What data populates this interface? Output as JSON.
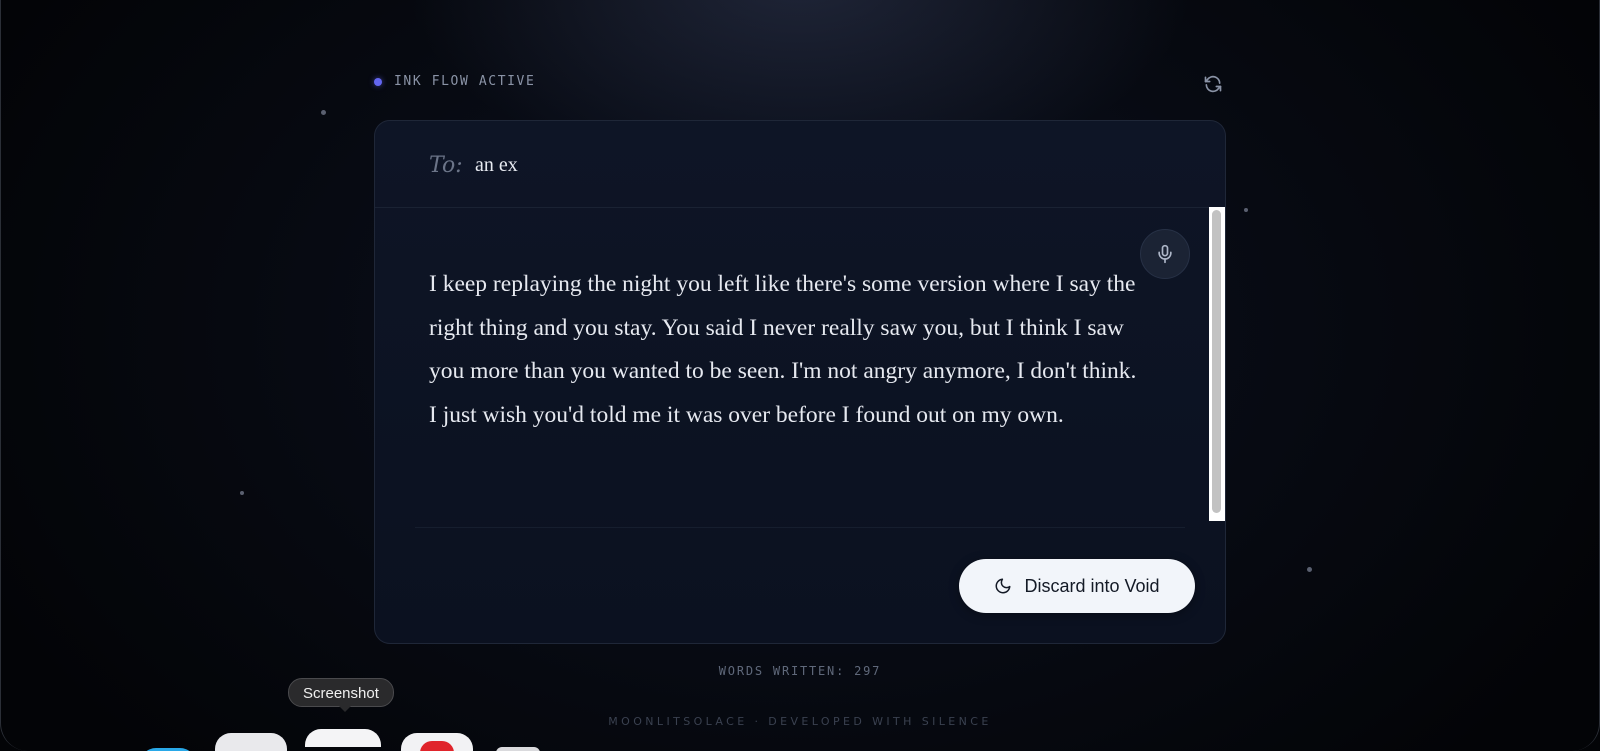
{
  "status": {
    "indicator_label": "INK FLOW ACTIVE",
    "indicator_color": "#6366f1"
  },
  "letter": {
    "to_label": "To:",
    "recipient": "an ex",
    "body": "I keep replaying the night you left like there's some version where I say the right thing and you stay. You said I never really saw you, but I think I saw you more than you wanted to be seen. I'm not angry anymore, I don't think. I just wish you'd told me it was over before I found out on my own."
  },
  "actions": {
    "discard_label": "Discard into Void"
  },
  "stats": {
    "words_written": "WORDS WRITTEN: 297"
  },
  "footer": {
    "text": "MOONLITSOLACE · DEVELOPED WITH SILENCE"
  },
  "dock": {
    "tooltip": "Screenshot"
  },
  "icons": {
    "refresh": "refresh-icon",
    "microphone": "microphone-icon",
    "moon": "moon-icon"
  }
}
